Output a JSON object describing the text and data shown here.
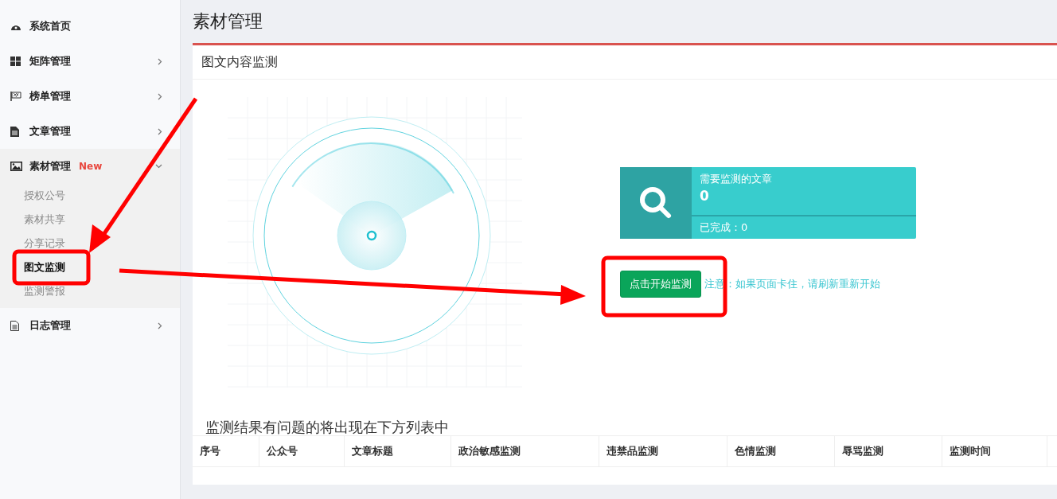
{
  "sidebar": {
    "items": [
      {
        "label": "系统首页",
        "kind": "link"
      },
      {
        "label": "矩阵管理",
        "kind": "group",
        "expanded": false
      },
      {
        "label": "榜单管理",
        "kind": "group",
        "expanded": false
      },
      {
        "label": "文章管理",
        "kind": "group",
        "expanded": false
      },
      {
        "label": "素材管理",
        "kind": "group",
        "expanded": true,
        "badge": "New",
        "children": [
          {
            "label": "授权公号",
            "selected": false
          },
          {
            "label": "素材共享",
            "selected": false
          },
          {
            "label": "分享记录",
            "selected": false
          },
          {
            "label": "图文监测",
            "selected": true
          },
          {
            "label": "监测警报",
            "selected": false
          }
        ]
      },
      {
        "label": "日志管理",
        "kind": "group",
        "expanded": false
      }
    ]
  },
  "page_title": "素材管理",
  "panel": {
    "title": "图文内容监测",
    "stat_card": {
      "label": "需要监测的文章",
      "value": "0",
      "footer": "已完成：0"
    },
    "start_button": "点击开始监测",
    "note": "注意：如果页面卡住，请刷新重新开始",
    "results_caption": "监测结果有问题的将出现在下方列表中",
    "table": {
      "columns": [
        "序号",
        "公众号",
        "文章标题",
        "政治敏感监测",
        "违禁品监测",
        "色情监测",
        "辱骂监测",
        "监测时间"
      ]
    }
  }
}
